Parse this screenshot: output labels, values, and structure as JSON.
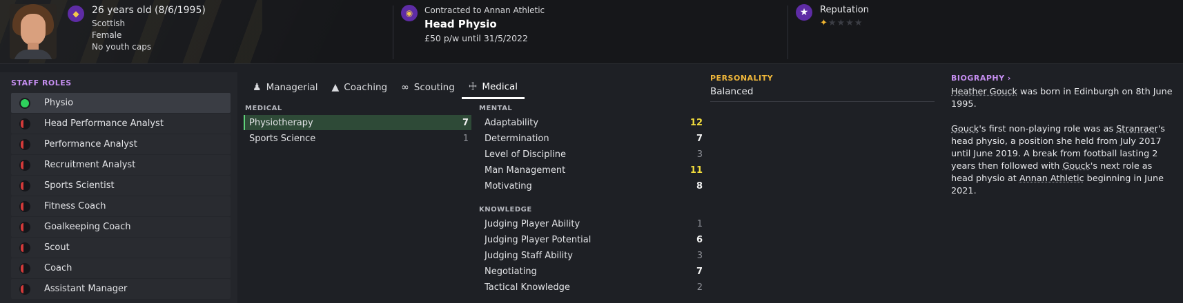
{
  "header": {
    "age": "26 years old (8/6/1995)",
    "nationality": "Scottish",
    "gender": "Female",
    "caps": "No youth caps",
    "contract_label": "Contracted to Annan Athletic",
    "job_title": "Head Physio",
    "wage": "£50 p/w until 31/5/2022",
    "reputation_label": "Reputation",
    "reputation_stars": 0.5
  },
  "icons": {
    "badge_colour": "#5e2ca5",
    "badge_icon": "club-crest-icon",
    "reputation_icon": "star-icon"
  },
  "sidebar": {
    "title": "STAFF ROLES",
    "roles": [
      {
        "label": "Physio",
        "status": "green"
      },
      {
        "label": "Head Performance Analyst",
        "status": "red"
      },
      {
        "label": "Performance Analyst",
        "status": "red"
      },
      {
        "label": "Recruitment Analyst",
        "status": "red"
      },
      {
        "label": "Sports Scientist",
        "status": "red"
      },
      {
        "label": "Fitness Coach",
        "status": "red"
      },
      {
        "label": "Goalkeeping Coach",
        "status": "red"
      },
      {
        "label": "Scout",
        "status": "red"
      },
      {
        "label": "Coach",
        "status": "red"
      },
      {
        "label": "Assistant Manager",
        "status": "red"
      }
    ]
  },
  "tabs": [
    {
      "label": "Managerial",
      "icon": "person-icon"
    },
    {
      "label": "Coaching",
      "icon": "cones-icon"
    },
    {
      "label": "Scouting",
      "icon": "binoculars-icon"
    },
    {
      "label": "Medical",
      "icon": "medical-kit-icon"
    }
  ],
  "medical": {
    "title": "MEDICAL",
    "rows": [
      {
        "label": "Physiotherapy",
        "value": "7",
        "tone": "normal"
      },
      {
        "label": "Sports Science",
        "value": "1",
        "tone": "dim"
      }
    ]
  },
  "mental": {
    "title": "MENTAL",
    "rows": [
      {
        "label": "Adaptability",
        "value": "12",
        "tone": "hi"
      },
      {
        "label": "Determination",
        "value": "7",
        "tone": "normal"
      },
      {
        "label": "Level of Discipline",
        "value": "3",
        "tone": "dim"
      },
      {
        "label": "Man Management",
        "value": "11",
        "tone": "hi"
      },
      {
        "label": "Motivating",
        "value": "8",
        "tone": "normal"
      }
    ]
  },
  "knowledge": {
    "title": "KNOWLEDGE",
    "rows": [
      {
        "label": "Judging Player Ability",
        "value": "1",
        "tone": "dim"
      },
      {
        "label": "Judging Player Potential",
        "value": "6",
        "tone": "normal"
      },
      {
        "label": "Judging Staff Ability",
        "value": "3",
        "tone": "dim"
      },
      {
        "label": "Negotiating",
        "value": "7",
        "tone": "normal"
      },
      {
        "label": "Tactical Knowledge",
        "value": "2",
        "tone": "dim"
      }
    ]
  },
  "personality": {
    "title": "PERSONALITY",
    "value": "Balanced"
  },
  "biography": {
    "title": "BIOGRAPHY ›",
    "p1_name": "Heather Gouck",
    "p1_rest": " was born in Edinburgh on 8th June 1995.",
    "p2_a": "Gouck",
    "p2_b": "'s first non-playing role was as ",
    "p2_c": "Stranraer",
    "p2_d": "'s head physio, a position she held from July 2017 until June 2019. A break from football lasting 2 years then followed with ",
    "p2_e": "Gouck",
    "p2_f": "'s next role as head physio at ",
    "p2_g": "Annan Athletic",
    "p2_h": " beginning in June 2021."
  }
}
